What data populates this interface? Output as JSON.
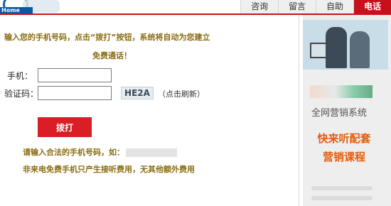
{
  "header": {
    "home_label": "Home",
    "tabs": [
      {
        "label": "咨询",
        "active": false
      },
      {
        "label": "留言",
        "active": false
      },
      {
        "label": "自助",
        "active": false
      },
      {
        "label": "电话",
        "active": true
      }
    ]
  },
  "form": {
    "intro": "输入您的手机号码，点击“拨打”按钮，系统将自动为您建立",
    "intro2": "免费通话！",
    "phone_label": "手机：",
    "phone_value": "",
    "captcha_label": "验证码：",
    "captcha_value": "",
    "captcha_text": "HE2A",
    "refresh_label": "（点击刷新）",
    "dial_label": "拨打",
    "tip1": "请输入合法的手机号码，如：",
    "tip2": "非来电免费手机只产生接听费用，无其他额外费用"
  },
  "sidebar": {
    "subtitle": "全网营销系统",
    "promo_line1": "快来听配套",
    "promo_line2": "营销课程"
  },
  "colors": {
    "accent": "#c8101a",
    "dial_button": "#d91e25",
    "tip_text": "#8a6d0f",
    "promo_text": "#e25c0b"
  }
}
